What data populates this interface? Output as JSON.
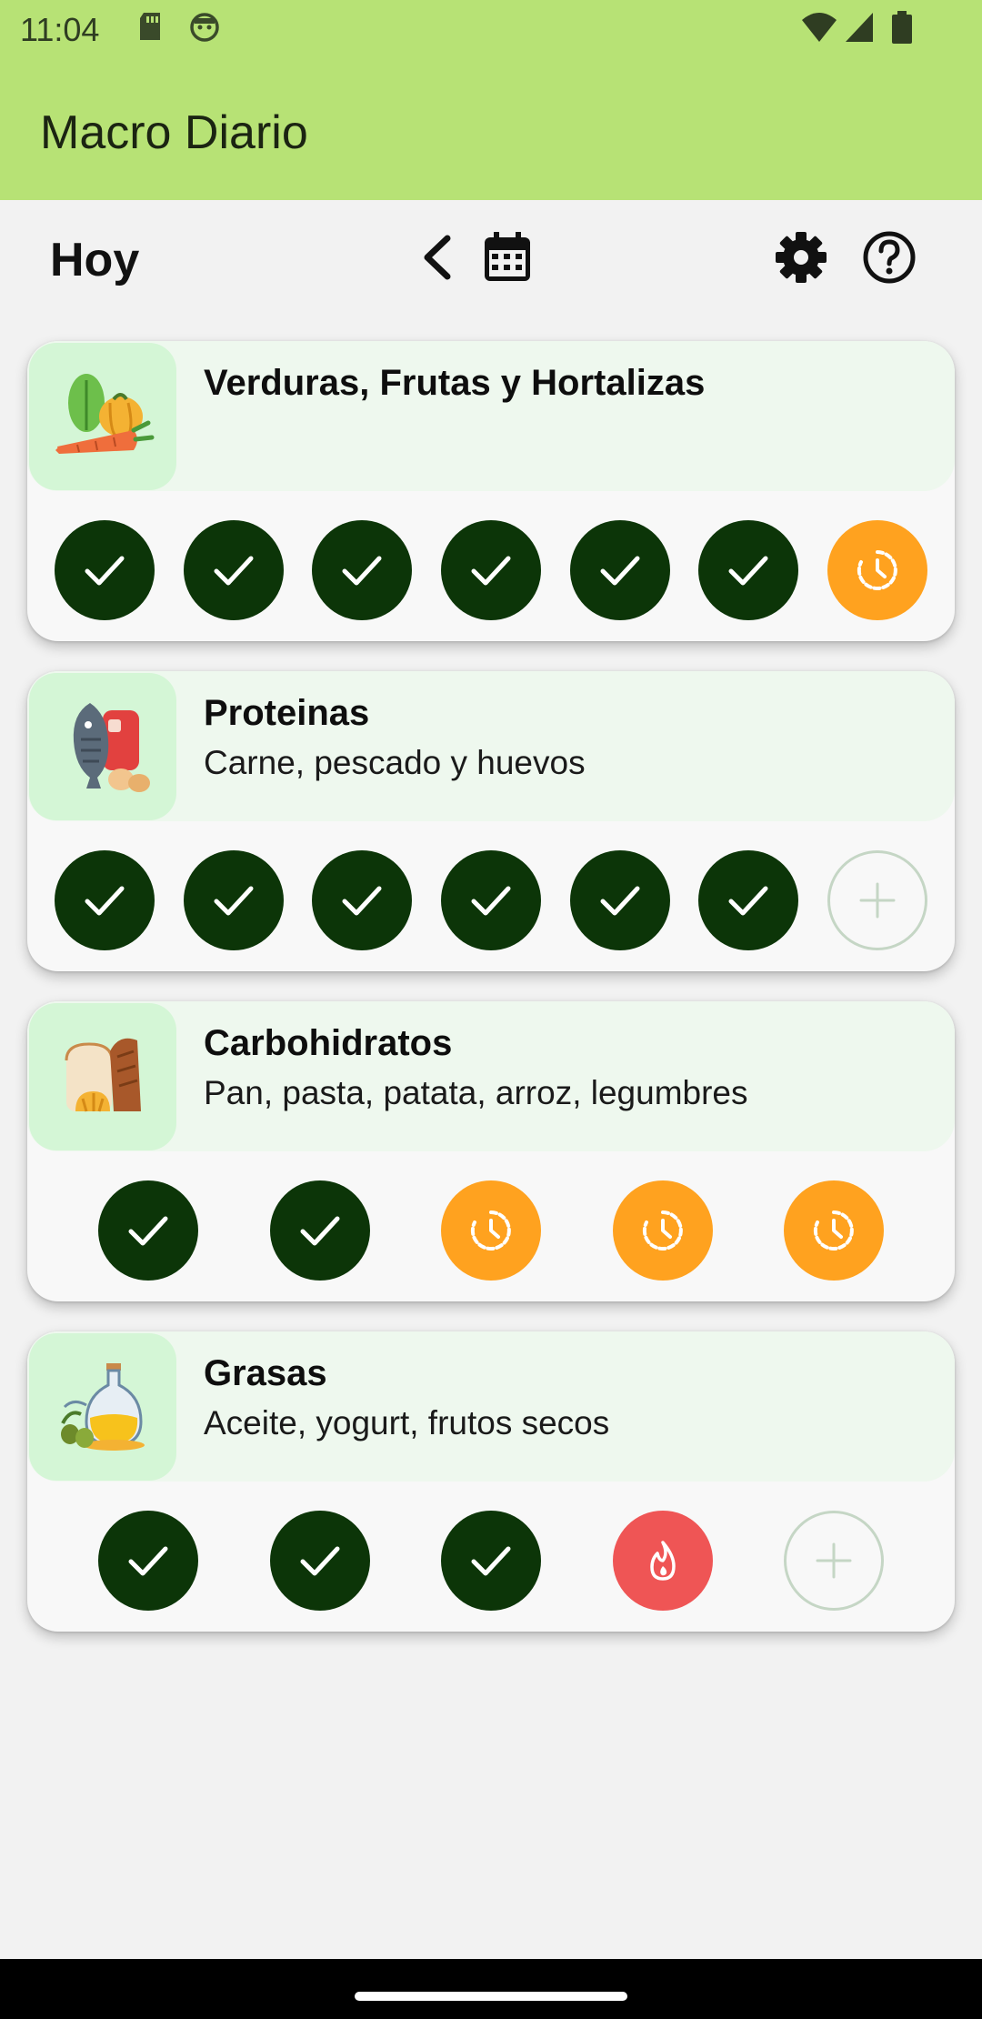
{
  "status": {
    "time": "11:04"
  },
  "app": {
    "title": "Macro Diario"
  },
  "toolbar": {
    "day_label": "Hoy"
  },
  "colors": {
    "accent": "#b7e275",
    "done": "#0c3508",
    "pending": "#ffa21f",
    "fire": "#ef5555"
  },
  "cards": [
    {
      "title": "Verduras, Frutas y Hortalizas",
      "subtitle": "",
      "icon": "vegetables-icon",
      "slots": [
        "done",
        "done",
        "done",
        "done",
        "done",
        "done",
        "pending"
      ]
    },
    {
      "title": "Proteinas",
      "subtitle": "Carne, pescado y huevos",
      "icon": "protein-icon",
      "slots": [
        "done",
        "done",
        "done",
        "done",
        "done",
        "done",
        "add"
      ]
    },
    {
      "title": "Carbohidratos",
      "subtitle": "Pan, pasta, patata, arroz, legumbres",
      "icon": "bread-icon",
      "slots": [
        "done",
        "done",
        "pending",
        "pending",
        "pending"
      ]
    },
    {
      "title": "Grasas",
      "subtitle": "Aceite, yogurt, frutos secos",
      "icon": "oil-icon",
      "slots": [
        "done",
        "done",
        "done",
        "fire",
        "add"
      ]
    }
  ]
}
